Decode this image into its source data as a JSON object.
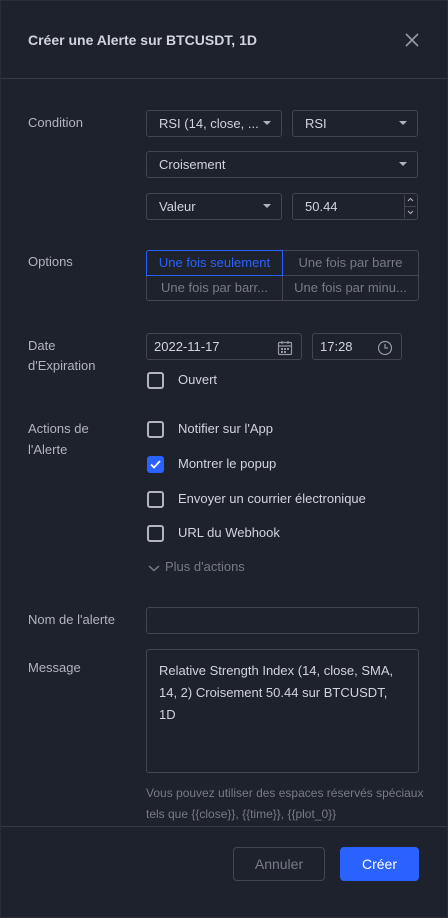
{
  "dialog": {
    "title": "Créer une Alerte sur BTCUSDT, 1D",
    "close_icon": "close-icon"
  },
  "condition": {
    "label": "Condition",
    "indicator": "RSI (14, close, ...",
    "plot": "RSI",
    "operator": "Croisement",
    "value_type": "Valeur",
    "value": "50.44"
  },
  "options": {
    "label": "Options",
    "segments": [
      {
        "label": "Une fois seulement",
        "active": true
      },
      {
        "label": "Une fois par barre",
        "active": false
      },
      {
        "label": "Une fois par barr...",
        "active": false
      },
      {
        "label": "Une fois par minu...",
        "active": false
      }
    ]
  },
  "expiration": {
    "label_line1": "Date",
    "label_line2": "d'Expiration",
    "date": "2022-11-17",
    "time": "17:28",
    "open_label": "Ouvert",
    "open_checked": false
  },
  "actions": {
    "label_line1": "Actions de",
    "label_line2": "l'Alerte",
    "items": [
      {
        "label": "Notifier sur l'App",
        "checked": false
      },
      {
        "label": "Montrer le popup",
        "checked": true
      },
      {
        "label": "Envoyer un courrier électronique",
        "checked": false
      },
      {
        "label": "URL du Webhook",
        "checked": false
      }
    ],
    "more_label": "Plus d'actions"
  },
  "alert_name": {
    "label": "Nom de l'alerte",
    "value": ""
  },
  "message": {
    "label": "Message",
    "value": "Relative Strength Index (14, close, SMA, 14, 2) Croisement 50.44 sur BTCUSDT, 1D",
    "hint": "Vous pouvez utiliser des espaces réservés spéciaux tels que {{close}}, {{time}}, {{plot_0}}"
  },
  "footer": {
    "cancel_label": "Annuler",
    "create_label": "Créer"
  },
  "colors": {
    "background": "#1e222d",
    "accent": "#2962ff",
    "border": "#434651",
    "text": "#d1d4dc",
    "muted": "#787b86"
  }
}
